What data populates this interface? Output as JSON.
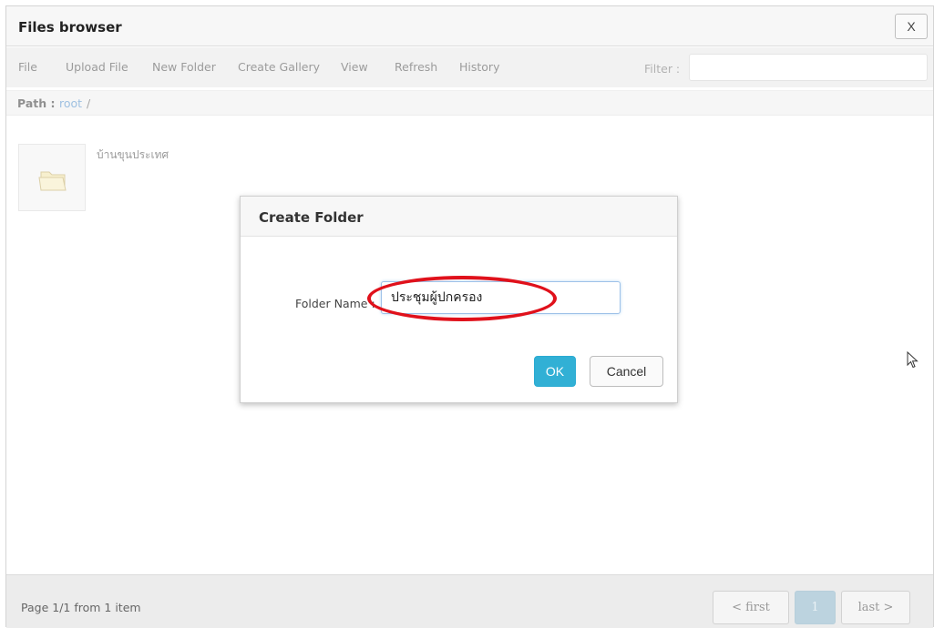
{
  "window": {
    "title": "Files browser",
    "close_label": "X"
  },
  "menu": {
    "items": [
      "File",
      "Upload File",
      "New Folder",
      "Create Gallery",
      "View",
      "Refresh",
      "History"
    ],
    "filter_label": "Filter :",
    "filter_value": ""
  },
  "path": {
    "label": "Path :",
    "root_link": "root",
    "separator": "/"
  },
  "files": [
    {
      "name": "บ้านขุนประเทศ",
      "icon": "folder-icon"
    }
  ],
  "dialog": {
    "title": "Create Folder",
    "field_label": "Folder Name :",
    "field_value": "ประชุมผู้ปกครอง",
    "ok_label": "OK",
    "cancel_label": "Cancel"
  },
  "footer": {
    "page_info": "Page 1/1 from 1 item",
    "first_label": "< first",
    "current_page": "1",
    "last_label": "last >"
  },
  "colors": {
    "accent": "#31b0d5",
    "annotation": "#e0111b",
    "link": "#6b9fd1"
  }
}
